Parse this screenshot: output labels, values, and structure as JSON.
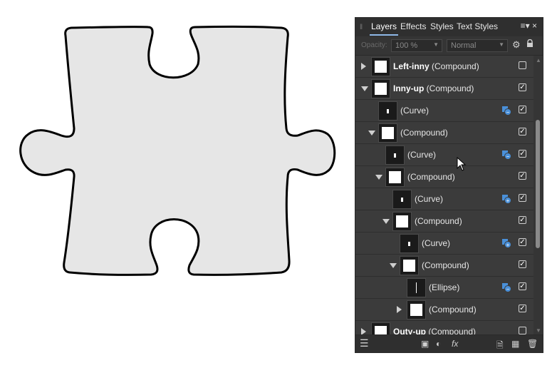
{
  "panel": {
    "tabs": [
      {
        "label": "Layers",
        "active": true
      },
      {
        "label": "Effects",
        "active": false
      },
      {
        "label": "Styles",
        "active": false
      },
      {
        "label": "Text Styles",
        "active": false
      }
    ],
    "menu_icon": "menu-icon",
    "opacity_label": "Opacity:",
    "opacity_value": "100 %",
    "blend_mode": "Normal"
  },
  "layers": [
    {
      "indent": 0,
      "expander": "collapsed",
      "bold": "Left-inny",
      "name": " (Compound)",
      "blend": "",
      "checked": false
    },
    {
      "indent": 0,
      "expander": "expanded",
      "bold": "Inny-up",
      "name": " (Compound)",
      "blend": "",
      "checked": true
    },
    {
      "indent": 1,
      "expander": "",
      "bold": "",
      "name": "(Curve)",
      "blend": "subtract",
      "checked": true
    },
    {
      "indent": 1,
      "expander": "expanded",
      "bold": "",
      "name": "(Compound)",
      "blend": "",
      "checked": true
    },
    {
      "indent": 2,
      "expander": "",
      "bold": "",
      "name": "(Curve)",
      "blend": "subtract",
      "checked": true
    },
    {
      "indent": 2,
      "expander": "expanded",
      "bold": "",
      "name": "(Compound)",
      "blend": "",
      "checked": true
    },
    {
      "indent": 3,
      "expander": "",
      "bold": "",
      "name": "(Curve)",
      "blend": "add",
      "checked": true
    },
    {
      "indent": 3,
      "expander": "expanded",
      "bold": "",
      "name": "(Compound)",
      "blend": "",
      "checked": true
    },
    {
      "indent": 4,
      "expander": "",
      "bold": "",
      "name": "(Curve)",
      "blend": "add",
      "checked": true
    },
    {
      "indent": 4,
      "expander": "expanded",
      "bold": "",
      "name": "(Compound)",
      "blend": "",
      "checked": true
    },
    {
      "indent": 5,
      "expander": "",
      "bold": "",
      "name": "(Ellipse)",
      "blend": "subtract",
      "checked": true
    },
    {
      "indent": 5,
      "expander": "collapsed",
      "bold": "",
      "name": "(Compound)",
      "blend": "",
      "checked": true
    },
    {
      "indent": 0,
      "expander": "collapsed",
      "bold": "Outy-up",
      "name": " (Compound)",
      "blend": "",
      "checked": false
    }
  ],
  "colors": {
    "panel_bg": "#3b3b3b",
    "accent": "#4a90d9",
    "shape_fill": "#e6e6e6",
    "shape_stroke": "#000000"
  }
}
